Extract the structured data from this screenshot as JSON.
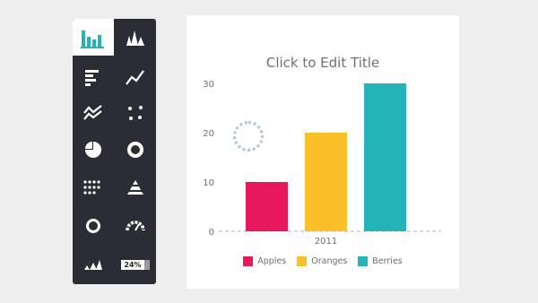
{
  "palette": {
    "items": [
      {
        "icon": "column-chart-icon"
      },
      {
        "icon": "mountain-chart-icon"
      },
      {
        "icon": "bar-chart-icon"
      },
      {
        "icon": "line-chart-icon"
      },
      {
        "icon": "area-chart-icon"
      },
      {
        "icon": "scatter-chart-icon"
      },
      {
        "icon": "pie-chart-icon"
      },
      {
        "icon": "donut-chart-icon"
      },
      {
        "icon": "dot-grid-chart-icon"
      },
      {
        "icon": "pyramid-chart-icon"
      },
      {
        "icon": "ring-chart-icon"
      },
      {
        "icon": "gauge-chart-icon"
      },
      {
        "icon": "sparkline-chart-icon"
      },
      {
        "icon": "percent-badge-icon",
        "label": "24%"
      }
    ],
    "selected_index": 0
  },
  "colors": {
    "palette_bg": "#2c2c35",
    "accent": "#23b3b8",
    "apples": "#e8185e",
    "oranges": "#fbbf29",
    "berries": "#23b3b8"
  },
  "chart_data": {
    "type": "bar",
    "title": "Click to Edit Title",
    "categories": [
      "2011"
    ],
    "series": [
      {
        "name": "Apples",
        "values": [
          10
        ],
        "color": "#e8185e"
      },
      {
        "name": "Oranges",
        "values": [
          20
        ],
        "color": "#fbbf29"
      },
      {
        "name": "Berries",
        "values": [
          30
        ],
        "color": "#23b3b8"
      }
    ],
    "ylim": [
      0,
      30
    ],
    "yticks": [
      0,
      10,
      20,
      30
    ],
    "grid": false,
    "legend": "bottom"
  }
}
